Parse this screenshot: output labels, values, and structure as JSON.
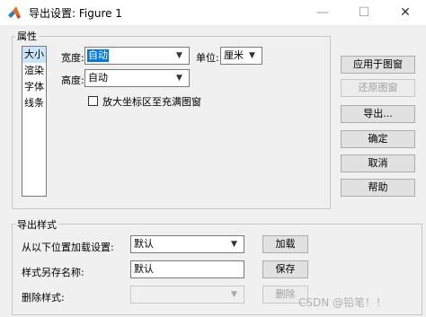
{
  "window": {
    "title": "导出设置: Figure 1",
    "minimize_icon": "minimize-icon",
    "maximize_icon": "maximize-icon",
    "close_icon": "close-icon"
  },
  "properties_group": {
    "label": "属性",
    "list_items": [
      "大小",
      "渲染",
      "字体",
      "线条"
    ],
    "selected_index": 0,
    "width_label": "宽度:",
    "width_value": "自动",
    "unit_label": "单位:",
    "unit_value": "厘米",
    "height_label": "高度:",
    "height_value": "自动",
    "expand_checkbox_label": "放大坐标区至充满图窗",
    "expand_checked": false
  },
  "side_buttons": {
    "apply": "应用于图窗",
    "restore": "还原图窗",
    "export": "导出...",
    "ok": "确定",
    "cancel": "取消",
    "help": "帮助"
  },
  "style_group": {
    "label": "导出样式",
    "load_label": "从以下位置加载设置:",
    "load_value": "默认",
    "load_button": "加载",
    "save_label": "样式另存名称:",
    "save_value": "默认",
    "save_button": "保存",
    "delete_label": "删除样式:",
    "delete_value": "",
    "delete_button": "删除"
  },
  "watermark": "CSDN @铅笔！！"
}
